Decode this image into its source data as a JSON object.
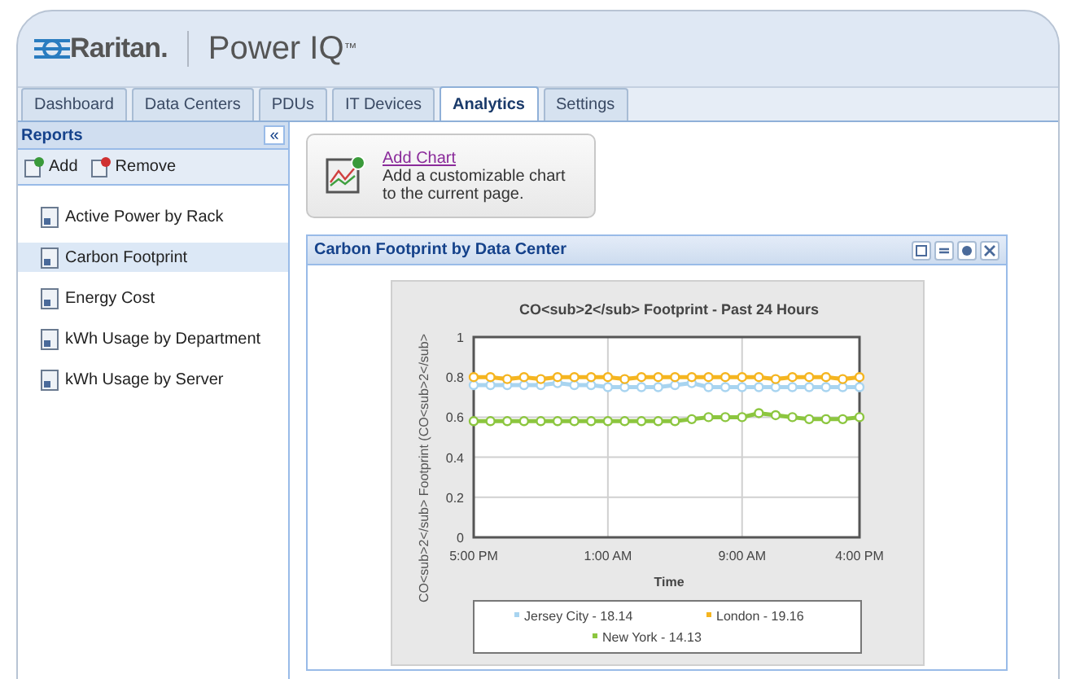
{
  "header": {
    "brand": "Raritan.",
    "product": "Power IQ",
    "trademark": "™"
  },
  "tabs": [
    {
      "label": "Dashboard",
      "selected": false
    },
    {
      "label": "Data Centers",
      "selected": false
    },
    {
      "label": "PDUs",
      "selected": false
    },
    {
      "label": "IT Devices",
      "selected": false
    },
    {
      "label": "Analytics",
      "selected": true
    },
    {
      "label": "Settings",
      "selected": false
    }
  ],
  "sidebar": {
    "title": "Reports",
    "collapse": "«",
    "actions": [
      "Add",
      "Remove"
    ],
    "items": [
      {
        "label": "Active Power by Rack",
        "selected": false
      },
      {
        "label": "Carbon Footprint",
        "selected": true
      },
      {
        "label": "Energy Cost",
        "selected": false
      },
      {
        "label": "kWh Usage by Department",
        "selected": false
      },
      {
        "label": "kWh Usage by Server",
        "selected": false
      }
    ]
  },
  "add_chart": {
    "link": "Add Chart",
    "description": "Add a customizable chart to the current page."
  },
  "panel": {
    "title": "Carbon Footprint by Data Center",
    "chart_data": {
      "type": "line",
      "title": "CO<sub>2</sub> Footprint - Past 24 Hours",
      "xlabel": "Time",
      "ylabel": "CO<sub>2</sub> Footprint (CO<sub>2</sub>",
      "categories": [
        "5:00 PM",
        null,
        null,
        null,
        null,
        null,
        null,
        null,
        "1:00 AM",
        null,
        null,
        null,
        null,
        null,
        null,
        null,
        "9:00 AM",
        null,
        null,
        null,
        null,
        null,
        null,
        "4:00 PM"
      ],
      "ylim": [
        0,
        1
      ],
      "yticks": [
        0,
        0.2,
        0.4,
        0.6,
        0.8,
        1
      ],
      "grid": true,
      "legend": "bottom",
      "series": [
        {
          "name": "Jersey City - 18.14",
          "color": "#a8d4f0",
          "marker": "circle",
          "values": [
            0.76,
            0.76,
            0.76,
            0.76,
            0.76,
            0.77,
            0.76,
            0.76,
            0.75,
            0.75,
            0.75,
            0.75,
            0.76,
            0.77,
            0.75,
            0.75,
            0.75,
            0.75,
            0.75,
            0.75,
            0.75,
            0.75,
            0.75,
            0.75
          ]
        },
        {
          "name": "London - 19.16",
          "color": "#f5b520",
          "marker": "circle",
          "values": [
            0.8,
            0.8,
            0.79,
            0.8,
            0.79,
            0.8,
            0.8,
            0.8,
            0.8,
            0.79,
            0.8,
            0.8,
            0.8,
            0.8,
            0.8,
            0.8,
            0.8,
            0.8,
            0.79,
            0.8,
            0.8,
            0.8,
            0.79,
            0.8
          ]
        },
        {
          "name": "New York - 14.13",
          "color": "#8cc63f",
          "marker": "circle",
          "values": [
            0.58,
            0.58,
            0.58,
            0.58,
            0.58,
            0.58,
            0.58,
            0.58,
            0.58,
            0.58,
            0.58,
            0.58,
            0.58,
            0.59,
            0.6,
            0.6,
            0.6,
            0.62,
            0.61,
            0.6,
            0.59,
            0.59,
            0.59,
            0.6
          ]
        }
      ]
    }
  }
}
